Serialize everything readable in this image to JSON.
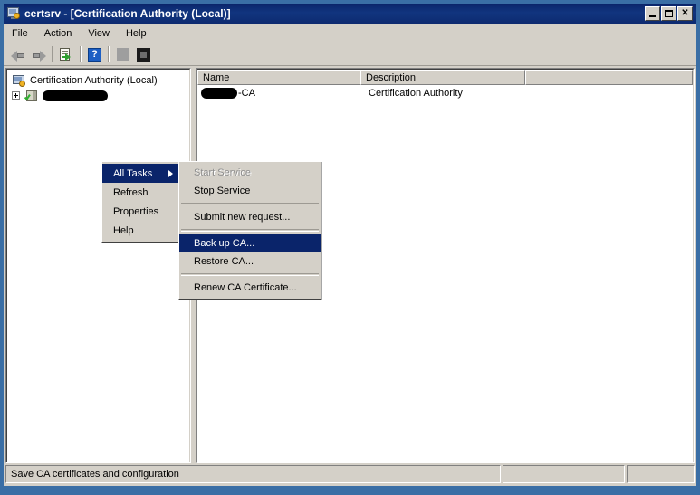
{
  "window": {
    "title": "certsrv - [Certification Authority (Local)]",
    "icon": "mmc-console-icon",
    "buttons": {
      "minimize": "_",
      "maximize": "□",
      "close": "✕"
    }
  },
  "menu_bar": {
    "items": [
      {
        "label": "File"
      },
      {
        "label": "Action"
      },
      {
        "label": "View"
      },
      {
        "label": "Help"
      }
    ]
  },
  "toolbar": {
    "buttons": [
      {
        "name": "back-button",
        "icon": "back-arrow-icon",
        "label": "Back"
      },
      {
        "name": "forward-button",
        "icon": "forward-arrow-icon",
        "label": "Forward"
      },
      {
        "name": "export-list-button",
        "icon": "export-list-icon",
        "label": "Export List"
      },
      {
        "name": "help-button",
        "icon": "question-mark-icon",
        "label": "?"
      },
      {
        "name": "show-hide-tree-button",
        "icon": "gray-square-icon",
        "label": "Show/Hide Console Tree"
      },
      {
        "name": "properties-button",
        "icon": "dark-square-icon",
        "label": "Properties"
      }
    ]
  },
  "tree": {
    "root": {
      "label": "Certification Authority (Local)",
      "icon": "certification-authority-icon"
    },
    "child": {
      "label": "",
      "redacted": true,
      "icon": "ca-certificate-icon",
      "expander": "+"
    }
  },
  "list": {
    "columns": [
      {
        "label": "Name"
      },
      {
        "label": "Description"
      },
      {
        "label": ""
      }
    ],
    "rows": [
      {
        "name_redacted": true,
        "name_suffix": "-CA",
        "description": "Certification Authority"
      }
    ]
  },
  "context_menu": {
    "items": [
      {
        "label": "All Tasks",
        "selected": true,
        "submenu": true
      },
      {
        "label": "Refresh",
        "selected": false,
        "submenu": false
      },
      {
        "label": "Properties",
        "selected": false,
        "submenu": false
      },
      {
        "label": "Help",
        "selected": false,
        "submenu": false
      }
    ]
  },
  "submenu": {
    "items": [
      {
        "label": "Start Service",
        "disabled": true,
        "selected": false,
        "separator_after": false
      },
      {
        "label": "Stop Service",
        "disabled": false,
        "selected": false,
        "separator_after": true
      },
      {
        "label": "Submit new request...",
        "disabled": false,
        "selected": false,
        "separator_after": true
      },
      {
        "label": "Back up CA...",
        "disabled": false,
        "selected": true,
        "separator_after": false
      },
      {
        "label": "Restore CA...",
        "disabled": false,
        "selected": false,
        "separator_after": true
      },
      {
        "label": "Renew CA Certificate...",
        "disabled": false,
        "selected": false,
        "separator_after": false
      }
    ]
  },
  "status_bar": {
    "main": "Save CA certificates and configuration",
    "second": "",
    "third": ""
  },
  "colors": {
    "title_bar": "#0a246a",
    "window_frame": "#3a6ea5",
    "menu_highlight": "#0a246a",
    "face": "#d4d0c8",
    "disabled_text": "#8d8d8d"
  }
}
